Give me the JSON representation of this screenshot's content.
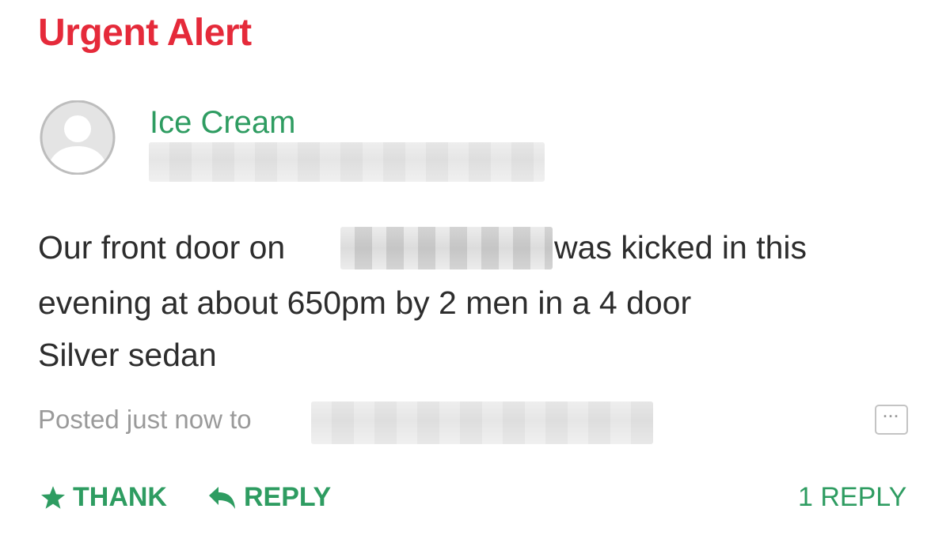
{
  "post": {
    "title": "Urgent Alert",
    "author": "Ice Cream",
    "body_line1_start": "Our front door on",
    "body_line1_end": "was kicked in this",
    "body_line2": "evening at about 650pm by 2 men in a 4 door",
    "body_line3": "Silver sedan",
    "posted_meta": "Posted just now to",
    "more_label": "···"
  },
  "actions": {
    "thank_label": "THANK",
    "reply_label": "REPLY",
    "reply_count_label": "1 REPLY"
  },
  "colors": {
    "alert_red": "#e52a3a",
    "accent_green": "#2e9c61",
    "meta_gray": "#9a9a9a"
  },
  "icons": {
    "avatar": "default-avatar-icon",
    "thank": "star-icon",
    "reply": "reply-arrow-icon",
    "more": "more-options-icon"
  }
}
